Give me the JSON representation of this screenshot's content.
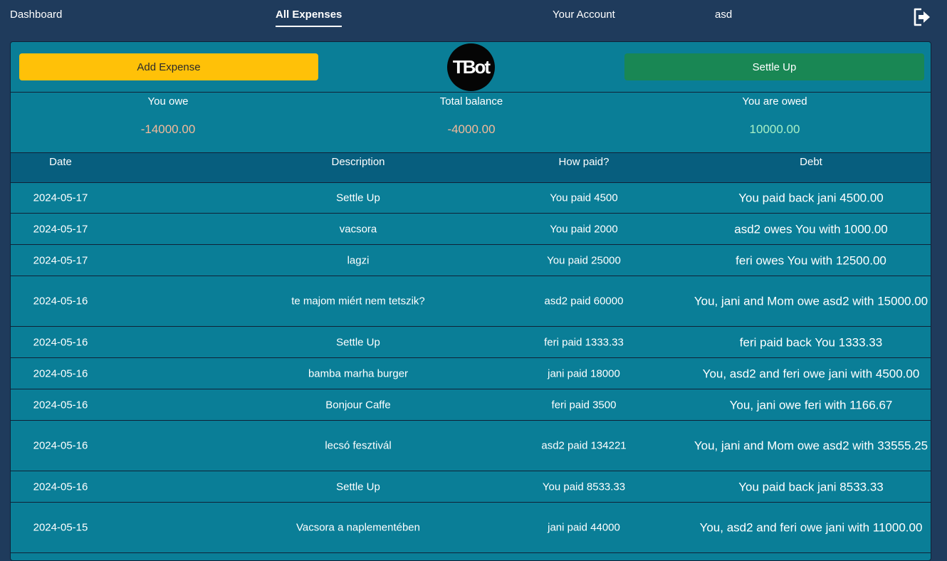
{
  "nav": {
    "dashboard": "Dashboard",
    "all_expenses": "All Expenses",
    "your_account": "Your Account",
    "username": "asd",
    "logout_icon": "logout-icon"
  },
  "actions": {
    "add_expense": "Add Expense",
    "settle_up": "Settle Up",
    "logo_text": "TBot"
  },
  "summary": {
    "you_owe_label": "You owe",
    "you_owe_value": "-14000.00",
    "total_label": "Total balance",
    "total_value": "-4000.00",
    "owed_label": "You are owed",
    "owed_value": "10000.00"
  },
  "table": {
    "headers": [
      "Date",
      "Description",
      "How paid?",
      "Debt"
    ],
    "rows": [
      {
        "date": "2024-05-17",
        "description": "Settle Up",
        "paid": "You paid 4500",
        "debt": "You paid back jani 4500.00",
        "status": "negative"
      },
      {
        "date": "2024-05-17",
        "description": "vacsora",
        "paid": "You paid 2000",
        "debt": "asd2 owes You with 1000.00",
        "status": "positive"
      },
      {
        "date": "2024-05-17",
        "description": "lagzi",
        "paid": "You paid 25000",
        "debt": "feri owes You with 12500.00",
        "status": "positive"
      },
      {
        "date": "2024-05-16",
        "description": "te majom miért nem tetszik?",
        "paid": "asd2 paid 60000",
        "debt": "You, jani and Mom owe asd2 with 15000.00",
        "status": "negative"
      },
      {
        "date": "2024-05-16",
        "description": "Settle Up",
        "paid": "feri paid 1333.33",
        "debt": "feri paid back You 1333.33",
        "status": "positive"
      },
      {
        "date": "2024-05-16",
        "description": "bamba marha burger",
        "paid": "jani paid 18000",
        "debt": "You, asd2 and feri owe jani with 4500.00",
        "status": "negative"
      },
      {
        "date": "2024-05-16",
        "description": "Bonjour Caffe",
        "paid": "feri paid 3500",
        "debt": "You, jani owe feri with 1166.67",
        "status": "negative"
      },
      {
        "date": "2024-05-16",
        "description": "lecsó fesztivál",
        "paid": "asd2 paid 134221",
        "debt": "You, jani and Mom owe asd2 with 33555.25",
        "status": "negative"
      },
      {
        "date": "2024-05-16",
        "description": "Settle Up",
        "paid": "You paid 8533.33",
        "debt": "You paid back jani 8533.33",
        "status": "negative"
      },
      {
        "date": "2024-05-15",
        "description": "Vacsora a naplementében",
        "paid": "jani paid 44000",
        "debt": "You, asd2 and feri owe jani with 11000.00",
        "status": "negative"
      }
    ]
  },
  "colors": {
    "negative": "#f2b99a",
    "positive": "#a6f0c6"
  }
}
